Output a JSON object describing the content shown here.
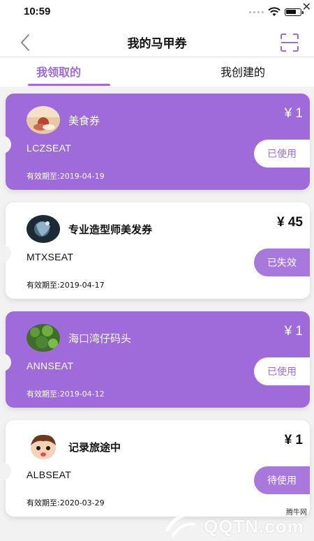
{
  "status_bar": {
    "time": "10:59"
  },
  "nav": {
    "title": "我的马甲券"
  },
  "tabs": [
    {
      "label": "我领取的",
      "active": true
    },
    {
      "label": "我创建的",
      "active": false
    }
  ],
  "coupons": [
    {
      "name": "美食券",
      "price": "¥ 1",
      "code": "LCZSEAT",
      "expiry": "有效期至:2019-04-19",
      "status": "已使用",
      "theme": "purple"
    },
    {
      "name": "专业造型师美发券",
      "price": "¥ 45",
      "code": "MTXSEAT",
      "expiry": "有效期至:2019-04-17",
      "status": "已失效",
      "theme": "white"
    },
    {
      "name": "海口湾仔码头",
      "price": "¥ 1",
      "code": "ANNSEAT",
      "expiry": "有效期至:2019-04-12",
      "status": "已使用",
      "theme": "purple"
    },
    {
      "name": "记录旅途中",
      "price": "¥ 1",
      "code": "ALBSEAT",
      "expiry": "有效期至:2020-03-29",
      "status": "待使用",
      "theme": "white"
    }
  ],
  "watermark": {
    "text": "QQTN.com",
    "small": "腾牛网"
  },
  "colors": {
    "accent": "#9f6ad9",
    "background": "#f2f2f2"
  }
}
